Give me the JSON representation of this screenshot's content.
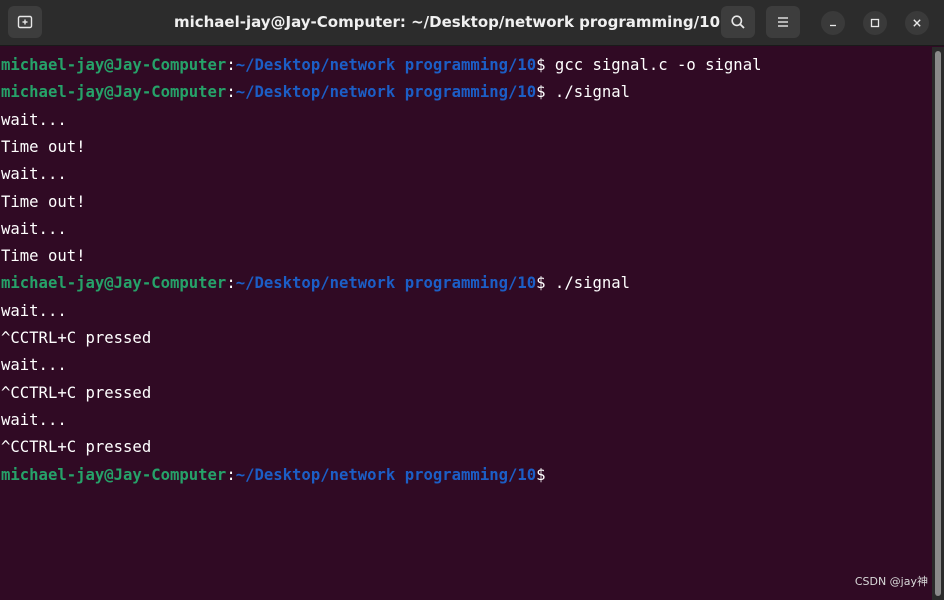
{
  "window": {
    "title": "michael-jay@Jay-Computer: ~/Desktop/network programming/10"
  },
  "titlebar": {
    "buttons": [
      {
        "name": "new-tab-button",
        "icon": "new-tab-icon"
      },
      {
        "name": "search-button",
        "icon": "search-icon"
      },
      {
        "name": "menu-button",
        "icon": "hamburger-icon"
      },
      {
        "name": "minimize-button",
        "icon": "minimize-icon"
      },
      {
        "name": "maximize-button",
        "icon": "maximize-icon"
      },
      {
        "name": "close-button",
        "icon": "close-icon"
      }
    ]
  },
  "prompt": {
    "user_host": "michael-jay@Jay-Computer",
    "colon": ":",
    "path": "~/Desktop/network programming/10",
    "dollar": "$"
  },
  "terminal": {
    "lines": [
      {
        "type": "prompt",
        "cmd": " gcc signal.c -o signal"
      },
      {
        "type": "prompt",
        "cmd": " ./signal"
      },
      {
        "type": "text",
        "text": "wait..."
      },
      {
        "type": "text",
        "text": "Time out!"
      },
      {
        "type": "text",
        "text": "wait..."
      },
      {
        "type": "text",
        "text": "Time out!"
      },
      {
        "type": "text",
        "text": "wait..."
      },
      {
        "type": "text",
        "text": "Time out!"
      },
      {
        "type": "prompt",
        "cmd": " ./signal"
      },
      {
        "type": "text",
        "text": "wait..."
      },
      {
        "type": "text",
        "text": "^CCTRL+C pressed"
      },
      {
        "type": "text",
        "text": "wait..."
      },
      {
        "type": "text",
        "text": "^CCTRL+C pressed"
      },
      {
        "type": "text",
        "text": "wait..."
      },
      {
        "type": "text",
        "text": "^CCTRL+C pressed"
      },
      {
        "type": "prompt",
        "cmd": ""
      }
    ]
  },
  "colors": {
    "terminal_bg": "#300a24",
    "user_host": "#26a269",
    "path": "#1c5ec6",
    "text": "#ffffff"
  },
  "watermark": "CSDN @jay神"
}
